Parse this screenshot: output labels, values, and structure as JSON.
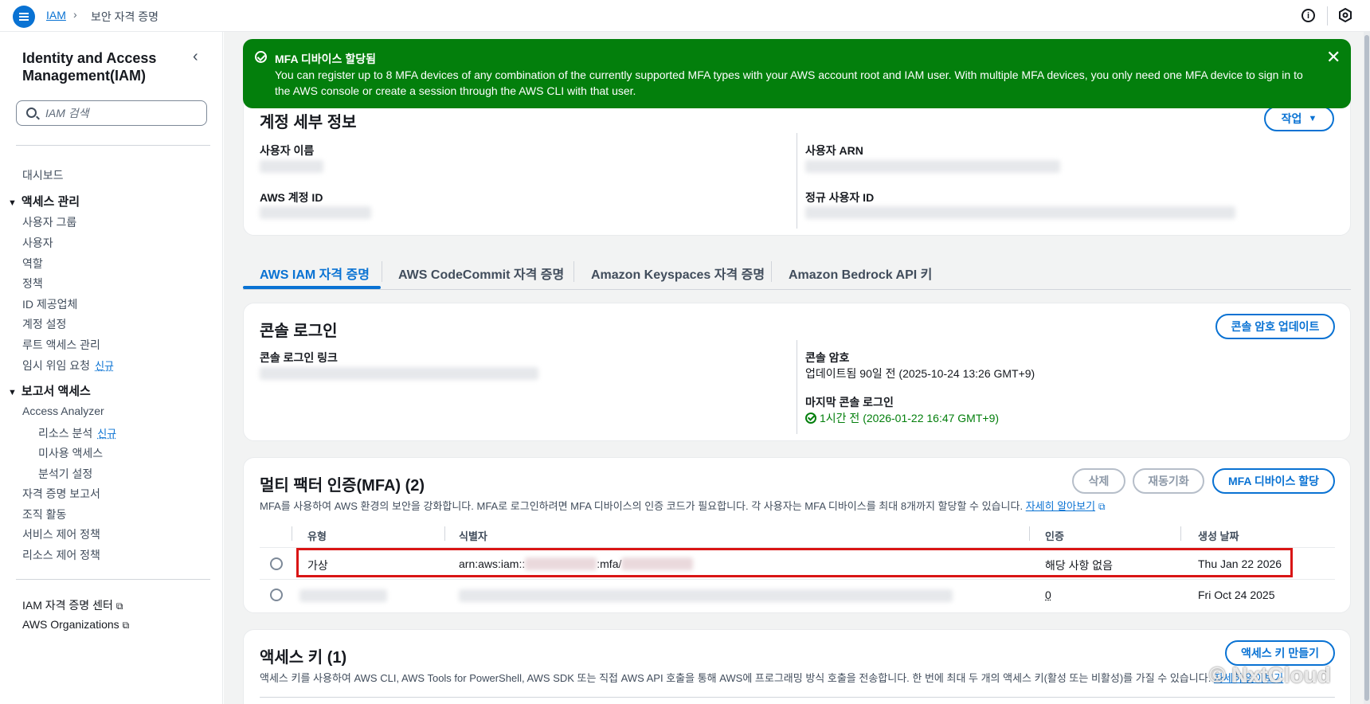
{
  "topbar": {
    "breadcrumb_root": "IAM",
    "breadcrumb_current": "보안 자격 증명"
  },
  "sidebar": {
    "title": "Identity and Access Management(IAM)",
    "search_placeholder": "IAM 검색",
    "dashboard": "대시보드",
    "access_management": {
      "label": "액세스 관리",
      "items": [
        "사용자 그룹",
        "사용자",
        "역할",
        "정책",
        "ID 제공업체",
        "계정 설정",
        "루트 액세스 관리",
        "임시 위임 요청"
      ],
      "new_badge": "신규"
    },
    "report_access": {
      "label": "보고서 액세스",
      "access_analyzer": "Access Analyzer",
      "sub_items": [
        "리소스 분석",
        "미사용 액세스",
        "분석기 설정"
      ],
      "new_badge": "신규",
      "items": [
        "자격 증명 보고서",
        "조직 활동",
        "서비스 제어 정책",
        "리소스 제어 정책"
      ]
    },
    "footer_links": [
      "IAM 자격 증명 센터",
      "AWS Organizations"
    ]
  },
  "flash": {
    "title": "MFA 디바이스 할당됨",
    "message": "You can register up to 8 MFA devices of any combination of the currently supported MFA types with your AWS account root and IAM user. With multiple MFA devices, you only need one MFA device to sign in to the AWS console or create a session through the AWS CLI with that user."
  },
  "account_details": {
    "title": "계정 세부 정보",
    "action_button": "작업",
    "user_name_label": "사용자 이름",
    "user_arn_label": "사용자 ARN",
    "account_id_label": "AWS 계정 ID",
    "canonical_id_label": "정규 사용자 ID"
  },
  "tabs": [
    "AWS IAM 자격 증명",
    "AWS CodeCommit 자격 증명",
    "Amazon Keyspaces 자격 증명",
    "Amazon Bedrock API 키"
  ],
  "console_signin": {
    "title": "콘솔 로그인",
    "update_button": "콘솔 암호 업데이트",
    "link_label": "콘솔 로그인 링크",
    "password_label": "콘솔 암호",
    "password_value": "업데이트됨 90일 전 (2025-10-24 13:26 GMT+9)",
    "last_signin_label": "마지막 콘솔 로그인",
    "last_signin_value": "1시간 전 (2026-01-22 16:47 GMT+9)"
  },
  "mfa": {
    "title": "멀티 팩터 인증(MFA) (2)",
    "delete_button": "삭제",
    "resync_button": "재동기화",
    "assign_button": "MFA 디바이스 할당",
    "description": "MFA를 사용하여 AWS 환경의 보안을 강화합니다. MFA로 로그인하려면 MFA 디바이스의 인증 코드가 필요합니다. 각 사용자는 MFA 디바이스를 최대 8개까지 할당할 수 있습니다.",
    "learn_more": "자세히 알아보기",
    "columns": [
      "유형",
      "식별자",
      "인증",
      "생성 날짜"
    ],
    "rows": [
      {
        "type": "가상",
        "id_prefix": "arn:aws:iam::",
        "id_middle": ":mfa/",
        "auth": "해당 사항 없음",
        "created": "Thu Jan 22 2026"
      },
      {
        "type": "",
        "auth": "0",
        "created": "Fri Oct 24 2025"
      }
    ]
  },
  "access_keys": {
    "title": "액세스 키 (1)",
    "create_button": "액세스 키 만들기",
    "description": "액세스 키를 사용하여 AWS CLI, AWS Tools for PowerShell, AWS SDK 또는 직접 AWS API 호출을 통해 AWS에 프로그래밍 방식 호출을 전송합니다. 한 번에 최대 두 개의 액세스 키(활성 또는 비활성)를 가질 수 있습니다.",
    "learn_more": "자세히 알아보기"
  },
  "watermark": "© NxtCloud",
  "colors": {
    "accent": "#0972d3",
    "success": "#037f0c",
    "highlight": "#d91515"
  }
}
